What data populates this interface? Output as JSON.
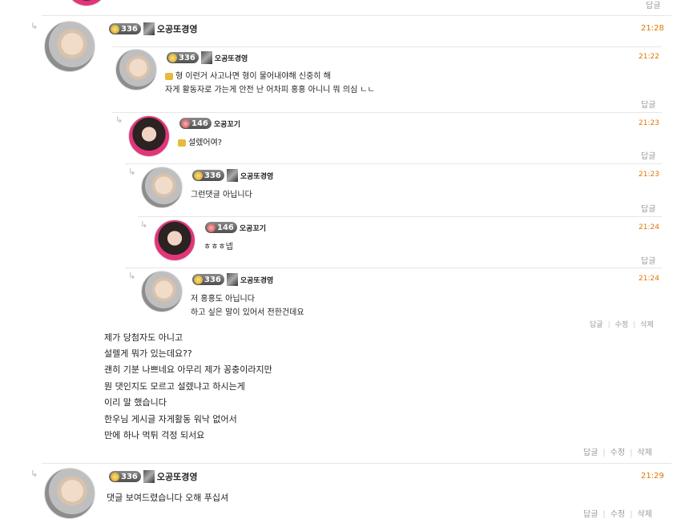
{
  "top": {
    "reply": "답글"
  },
  "comments": [
    {
      "level": "336",
      "nick": "오공또경영",
      "time": "21:28",
      "lines": []
    },
    {
      "level": "336",
      "nick": "오공또경영",
      "time": "21:22",
      "lines": [
        "형 이런거 사고나면 형이 물어내야해 신중히 해",
        "자게 활동자로 가는게 안전 난 어차피 홍홍 아니니 뭐 의심 ㄴㄴ"
      ],
      "reply": "답글"
    },
    {
      "level": "146",
      "nick": "오공꼬기",
      "time": "21:23",
      "lines": [
        "설렜어여?"
      ],
      "reply": "답글"
    },
    {
      "level": "336",
      "nick": "오공또경영",
      "time": "21:23",
      "lines": [
        "그런댓글 아닙니다"
      ],
      "reply": "답글"
    },
    {
      "level": "146",
      "nick": "오공꼬기",
      "time": "21:24",
      "lines": [
        "ㅎㅎㅎ넵"
      ],
      "reply": "답글"
    },
    {
      "level": "336",
      "nick": "오공또경영",
      "time": "21:24",
      "lines": [
        "저 홍홍도 아닙니다",
        "하고 싶은 말이 있어서 전한건데요"
      ],
      "reply": "답글",
      "edit": "수정",
      "delete": "삭제"
    }
  ],
  "body_lines": [
    "제가 당첨자도 아니고",
    "설렐게 뭐가 있는데요??",
    "괜히 기분 나쁘네요 아무리 제가 꽁충이라지만",
    "뭔 댓인지도 모르고 설렜냐고 하시는게",
    "이리 말 했습니다",
    "한우님 게시글 자게활동 워낙 없어서",
    "만에 하나 먹튀 걱정 되서요"
  ],
  "body_actions": {
    "reply": "답글",
    "edit": "수정",
    "delete": "삭제"
  },
  "last": {
    "level": "336",
    "nick": "오공또경영",
    "time": "21:29",
    "text": "댓글 보여드렸습니다 오해 푸십셔",
    "reply": "답글",
    "edit": "수정",
    "delete": "삭제"
  }
}
